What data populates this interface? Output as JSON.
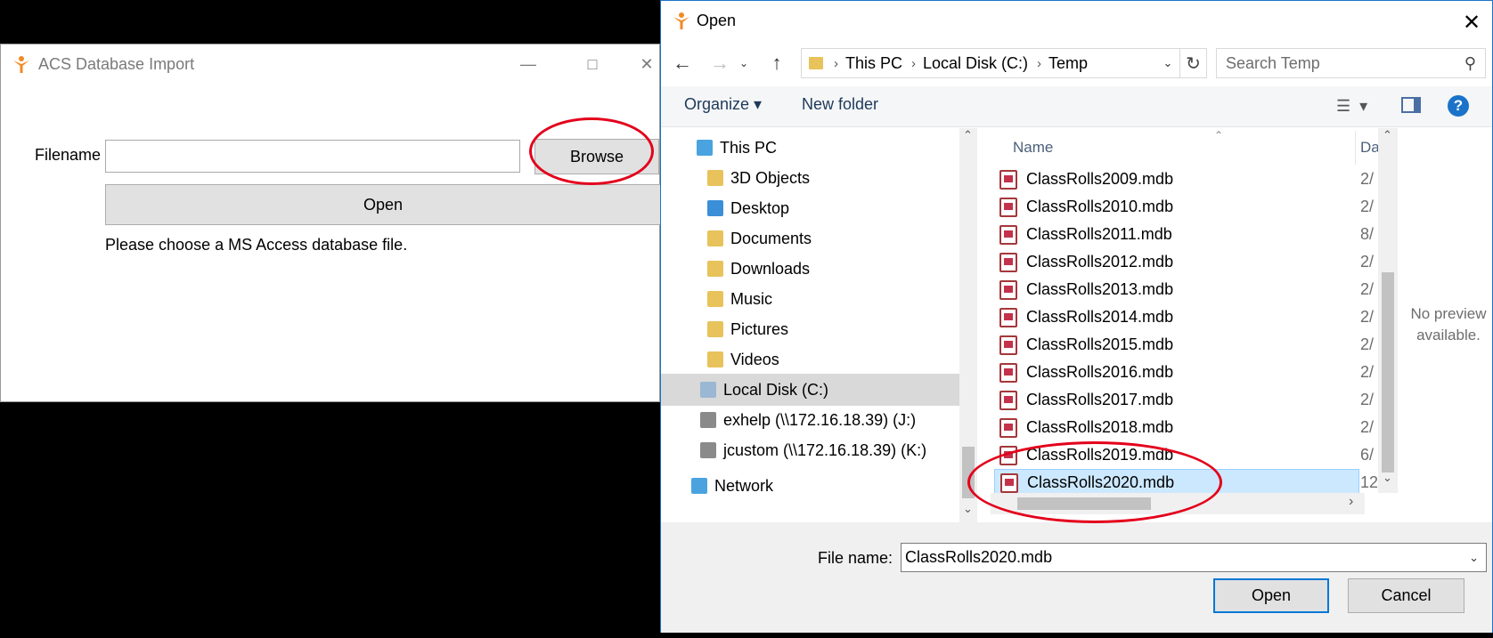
{
  "acs_window": {
    "title": "ACS Database Import",
    "filename_label": "Filename",
    "filename_value": "",
    "browse_label": "Browse",
    "open_label": "Open",
    "hint": "Please choose a MS Access database file."
  },
  "open_dialog": {
    "title": "Open",
    "breadcrumb": [
      "This PC",
      "Local Disk (C:)",
      "Temp"
    ],
    "search_placeholder": "Search Temp",
    "toolbar": {
      "organize": "Organize",
      "new_folder": "New folder"
    },
    "nav_items": [
      {
        "label": "This PC",
        "icon": "computer-icon"
      },
      {
        "label": "3D Objects",
        "icon": "3d-objects-folder-icon"
      },
      {
        "label": "Desktop",
        "icon": "desktop-folder-icon"
      },
      {
        "label": "Documents",
        "icon": "documents-folder-icon"
      },
      {
        "label": "Downloads",
        "icon": "downloads-folder-icon"
      },
      {
        "label": "Music",
        "icon": "music-folder-icon"
      },
      {
        "label": "Pictures",
        "icon": "pictures-folder-icon"
      },
      {
        "label": "Videos",
        "icon": "videos-folder-icon"
      },
      {
        "label": "Local Disk (C:)",
        "icon": "local-disk-icon",
        "selected": true
      },
      {
        "label": "exhelp (\\\\172.16.18.39) (J:)",
        "icon": "network-drive-disconnected-icon"
      },
      {
        "label": "jcustom (\\\\172.16.18.39) (K:)",
        "icon": "network-drive-disconnected-icon"
      },
      {
        "label": "Network",
        "icon": "network-icon"
      }
    ],
    "columns": {
      "name": "Name",
      "date": "Da"
    },
    "files": [
      {
        "name": "ClassRolls2009.mdb",
        "date": "2/"
      },
      {
        "name": "ClassRolls2010.mdb",
        "date": "2/"
      },
      {
        "name": "ClassRolls2011.mdb",
        "date": "8/"
      },
      {
        "name": "ClassRolls2012.mdb",
        "date": "2/"
      },
      {
        "name": "ClassRolls2013.mdb",
        "date": "2/"
      },
      {
        "name": "ClassRolls2014.mdb",
        "date": "2/"
      },
      {
        "name": "ClassRolls2015.mdb",
        "date": "2/"
      },
      {
        "name": "ClassRolls2016.mdb",
        "date": "2/"
      },
      {
        "name": "ClassRolls2017.mdb",
        "date": "2/"
      },
      {
        "name": "ClassRolls2018.mdb",
        "date": "2/"
      },
      {
        "name": "ClassRolls2019.mdb",
        "date": "6/"
      },
      {
        "name": "ClassRolls2020.mdb",
        "date": "12",
        "selected": true
      }
    ],
    "preview_text": "No preview available.",
    "file_name_label": "File name:",
    "file_name_value": "ClassRolls2020.mdb",
    "open_label": "Open",
    "cancel_label": "Cancel"
  },
  "colors": {
    "accent": "#0078d7",
    "annotation": "#e3001b",
    "selection": "#cce8ff"
  }
}
